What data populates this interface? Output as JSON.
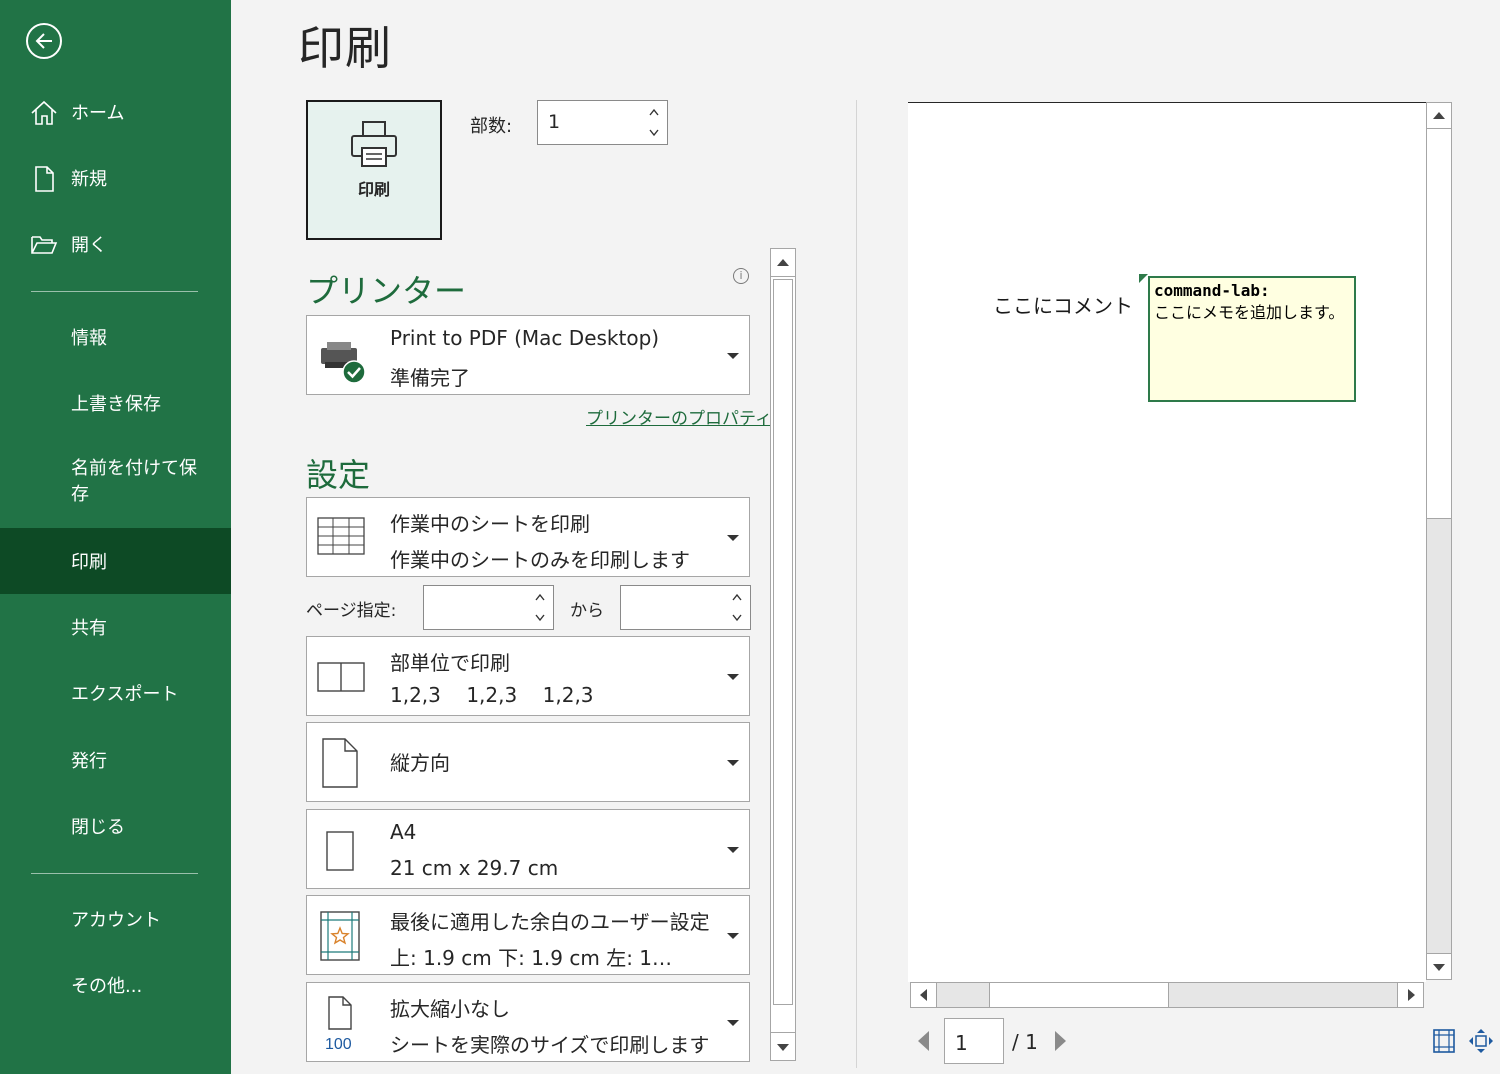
{
  "sidebar": {
    "items": [
      {
        "label": "ホーム"
      },
      {
        "label": "新規"
      },
      {
        "label": "開く"
      },
      {
        "label": "情報"
      },
      {
        "label": "上書き保存"
      },
      {
        "label": "名前を付けて保存"
      },
      {
        "label": "印刷"
      },
      {
        "label": "共有"
      },
      {
        "label": "エクスポート"
      },
      {
        "label": "発行"
      },
      {
        "label": "閉じる"
      },
      {
        "label": "アカウント"
      },
      {
        "label": "その他..."
      }
    ],
    "active": "印刷",
    "bg_color": "#217346",
    "active_color": "#0d4a25"
  },
  "main": {
    "title": "印刷",
    "print_button_label": "印刷",
    "copies": {
      "label": "部数:",
      "value": "1"
    },
    "printer": {
      "section_title": "プリンター",
      "name": "Print to PDF (Mac Desktop)",
      "status": "準備完了",
      "properties_link": "プリンターのプロパティ"
    },
    "settings": {
      "section_title": "設定",
      "print_what": {
        "title": "作業中のシートを印刷",
        "subtitle": "作業中のシートのみを印刷します"
      },
      "pages": {
        "label": "ページ指定:",
        "from_value": "",
        "to_label": "から",
        "to_value": ""
      },
      "collation": {
        "title": "部単位で印刷",
        "subtitle": "1,2,3    1,2,3    1,2,3"
      },
      "orientation": {
        "title": "縦方向"
      },
      "paper": {
        "title": "A4",
        "subtitle": "21 cm x 29.7 cm"
      },
      "margins": {
        "title": "最後に適用した余白のユーザー設定",
        "subtitle": "上: 1.9 cm 下: 1.9 cm 左: 1…"
      },
      "scaling": {
        "title": "拡大縮小なし",
        "subtitle": "シートを実際のサイズで印刷します",
        "icon_text": "100"
      }
    }
  },
  "preview": {
    "cell_text": "ここにコメント",
    "note": {
      "author": "command-lab:",
      "body": "ここにメモを追加します。"
    },
    "page": {
      "current": "1",
      "total": "/ 1"
    }
  },
  "colors": {
    "accent": "#1e6b3c",
    "note_bg": "#ffffe1",
    "note_border": "#2e7a4a"
  }
}
